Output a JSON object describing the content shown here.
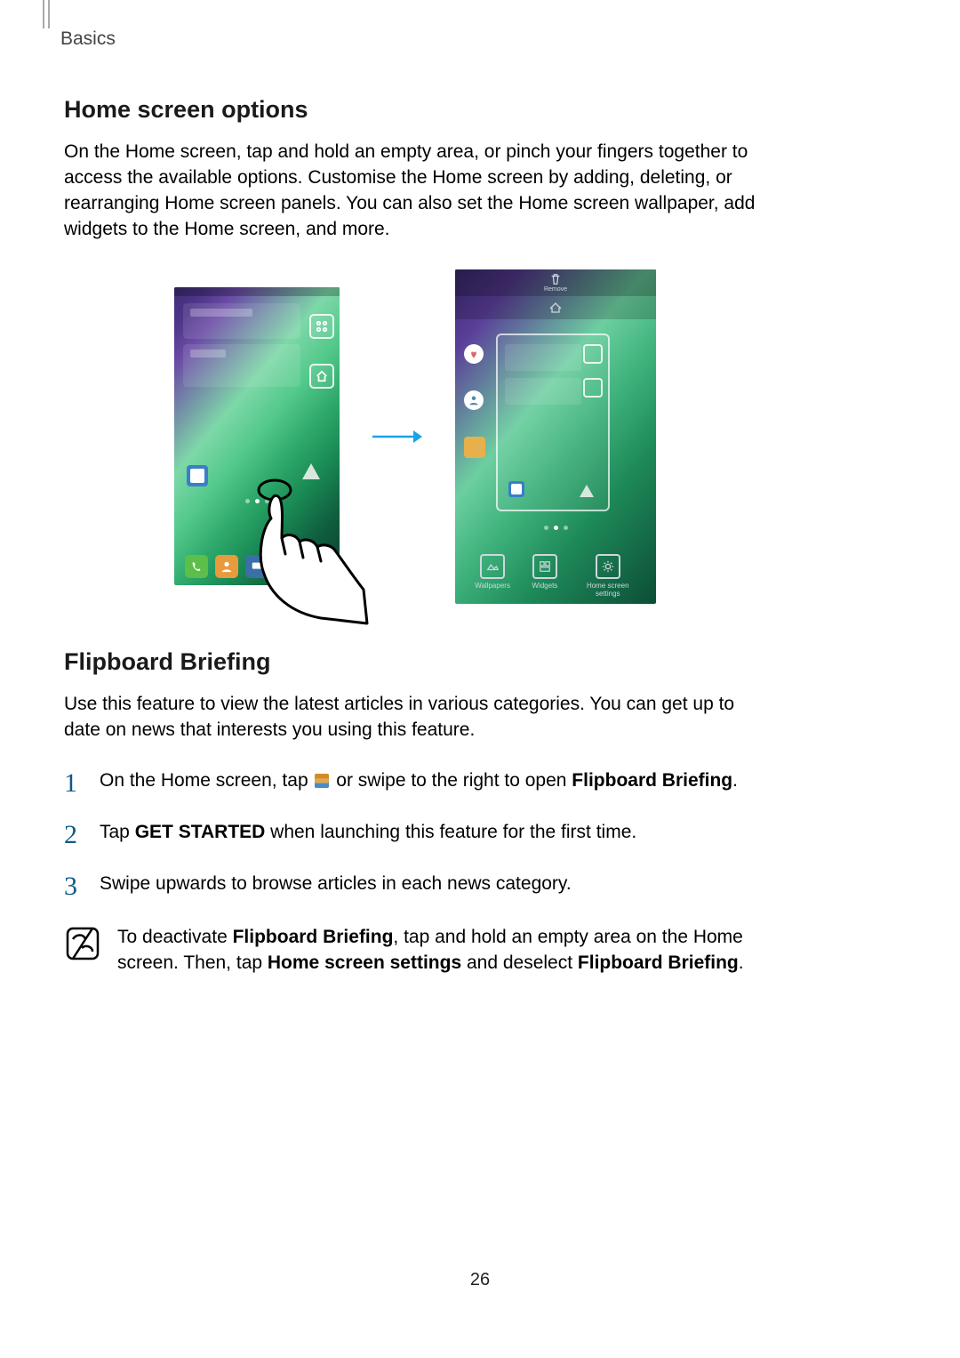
{
  "breadcrumb": "Basics",
  "section1": {
    "heading": "Home screen options",
    "para": "On the Home screen, tap and hold an empty area, or pinch your fingers together to access the available options. Customise the Home screen by adding, deleting, or rearranging Home screen panels. You can also set the Home screen wallpaper, add widgets to the Home screen, and more."
  },
  "section2": {
    "heading": "Flipboard Briefing",
    "para": "Use this feature to view the latest articles in various categories. You can get up to date on news that interests you using this feature.",
    "steps": {
      "s1_a": "On the Home screen, tap ",
      "s1_b": " or swipe to the right to open ",
      "s1_bold": "Flipboard Briefing",
      "s1_c": ".",
      "s2_a": "Tap ",
      "s2_bold": "GET STARTED",
      "s2_b": " when launching this feature for the first time.",
      "s3": "Swipe upwards to browse articles in each news category."
    },
    "note": {
      "a": "To deactivate ",
      "b1": "Flipboard Briefing",
      "c": ", tap and hold an empty area on the Home screen. Then, tap ",
      "b2": "Home screen settings",
      "d": " and deselect ",
      "b3": "Flipboard Briefing",
      "e": "."
    }
  },
  "phone2_opts": {
    "wallpapers": "Wallpapers",
    "widgets": "Widgets",
    "settings": "Home screen settings"
  },
  "phone2_topbar_label": "Remove",
  "pageNumber": "26"
}
